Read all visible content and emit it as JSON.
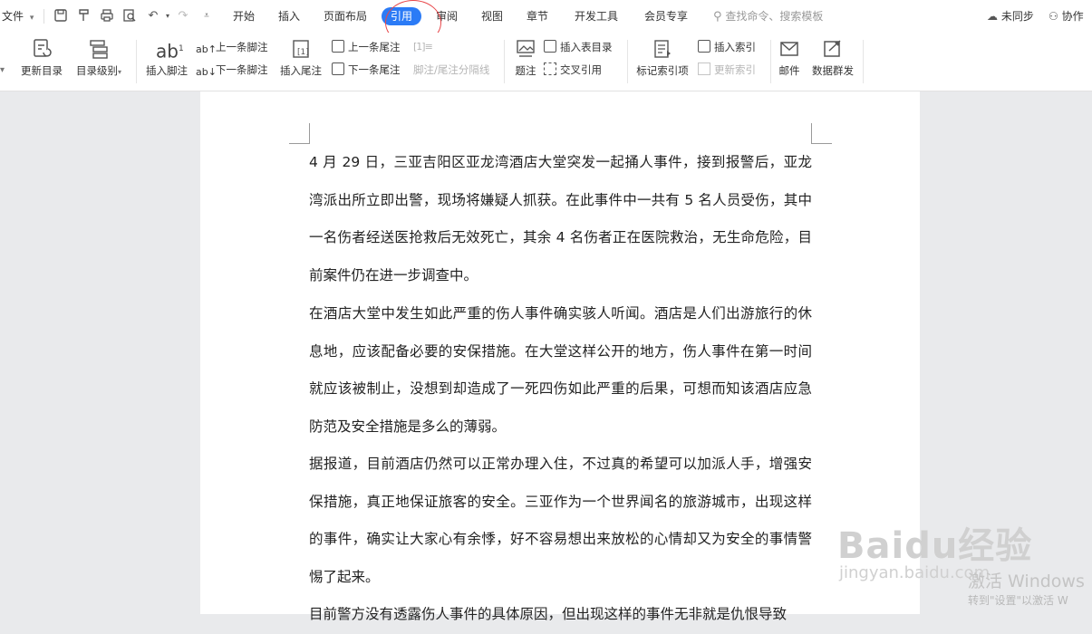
{
  "topbar": {
    "file_menu": "文件",
    "tabs": [
      "开始",
      "插入",
      "页面布局",
      "引用",
      "审阅",
      "视图",
      "章节",
      "开发工具",
      "会员专享"
    ],
    "search_placeholder": "查找命令、搜索模板",
    "sync_status": "未同步",
    "collab": "协作"
  },
  "ribbon": {
    "update_toc": "更新目录",
    "toc_level": "目录级别",
    "insert_footnote": "插入脚注",
    "prev_footnote": "上一条脚注",
    "next_footnote": "下一条脚注",
    "insert_endnote": "插入尾注",
    "prev_endnote": "上一条尾注",
    "next_endnote": "下一条尾注",
    "separator": "脚注/尾注分隔线",
    "caption": "题注",
    "insert_table_of_figures": "插入表目录",
    "cross_reference": "交叉引用",
    "mark_index_entry": "标记索引项",
    "insert_index": "插入索引",
    "update_index": "更新索引",
    "mail": "邮件",
    "data_send": "数据群发"
  },
  "document": {
    "paragraphs": [
      "4 月 29 日，三亚吉阳区亚龙湾酒店大堂突发一起捅人事件，接到报警后，亚龙湾派出所立即出警，现场将嫌疑人抓获。在此事件中一共有 5 名人员受伤，其中一名伤者经送医抢救后无效死亡，其余 4 名伤者正在医院救治，无生命危险，目前案件仍在进一步调查中。",
      "在酒店大堂中发生如此严重的伤人事件确实骇人听闻。酒店是人们出游旅行的休息地，应该配备必要的安保措施。在大堂这样公开的地方，伤人事件在第一时间就应该被制止，没想到却造成了一死四伤如此严重的后果，可想而知该酒店应急防范及安全措施是多么的薄弱。",
      "据报道，目前酒店仍然可以正常办理入住，不过真的希望可以加派人手，增强安保措施，真正地保证旅客的安全。三亚作为一个世界闻名的旅游城市，出现这样的事件，确实让大家心有余悸，好不容易想出来放松的心情却又为安全的事情警惕了起来。",
      "目前警方没有透露伤人事件的具体原因，但出现这样的事件无非就是仇恨导致"
    ]
  },
  "watermark": {
    "brand": "Baidu经验",
    "url": "jingyan.baidu.com",
    "activate_title": "激活 Windows",
    "activate_sub": "转到\"设置\"以激活 W"
  },
  "colors": {
    "accent": "#2b7bf6",
    "annotation": "#e8474a"
  }
}
